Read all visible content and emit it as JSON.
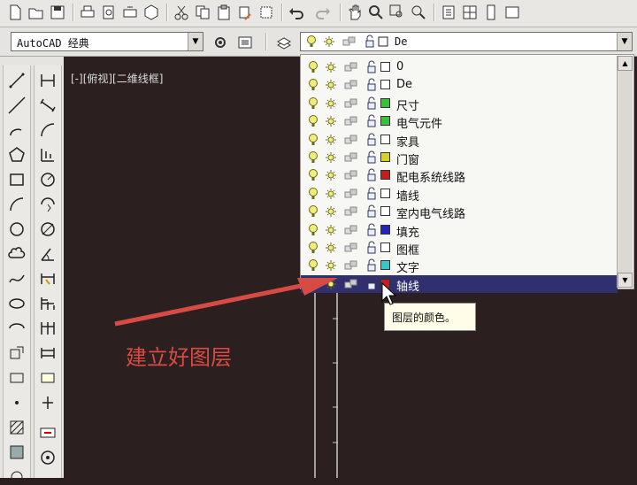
{
  "toolbar": {
    "tools": [
      "new-icon",
      "open-icon",
      "save-icon",
      "plot-icon",
      "plot-preview-icon",
      "publish-icon",
      "3d-dwf-icon",
      "cut-icon",
      "copy-icon",
      "paste-icon",
      "match-properties-icon",
      "block-editor-icon",
      "undo-icon",
      "redo-icon",
      "pan-icon",
      "zoom-realtime-icon",
      "zoom-window-icon",
      "zoom-previous-icon",
      "properties-icon",
      "design-center-icon",
      "tool-palettes-icon",
      "sheet-set-icon"
    ]
  },
  "workspace": {
    "value": "AutoCAD 经典"
  },
  "layer_combo": {
    "current_layer": "De"
  },
  "viewport": {
    "label": "[-][俯视][二维线框]"
  },
  "layers": [
    {
      "name": "0",
      "color": "#ffffff"
    },
    {
      "name": "De",
      "color": "#ffffff"
    },
    {
      "name": "尺寸",
      "color": "#35c435"
    },
    {
      "name": "电气元件",
      "color": "#35c435"
    },
    {
      "name": "家具",
      "color": "#ffffff"
    },
    {
      "name": "门窗",
      "color": "#d8d21e"
    },
    {
      "name": "配电系统线路",
      "color": "#c81c1c"
    },
    {
      "name": "墙线",
      "color": "#ffffff"
    },
    {
      "name": "室内电气线路",
      "color": "#ffffff"
    },
    {
      "name": "填充",
      "color": "#2323c8"
    },
    {
      "name": "图框",
      "color": "#ffffff"
    },
    {
      "name": "文字",
      "color": "#35c8c8"
    },
    {
      "name": "轴线",
      "color": "#c81c1c"
    }
  ],
  "selected_layer_index": 12,
  "tooltip": {
    "text": "图层的颜色。"
  },
  "annotation": {
    "text": "建立好图层"
  }
}
